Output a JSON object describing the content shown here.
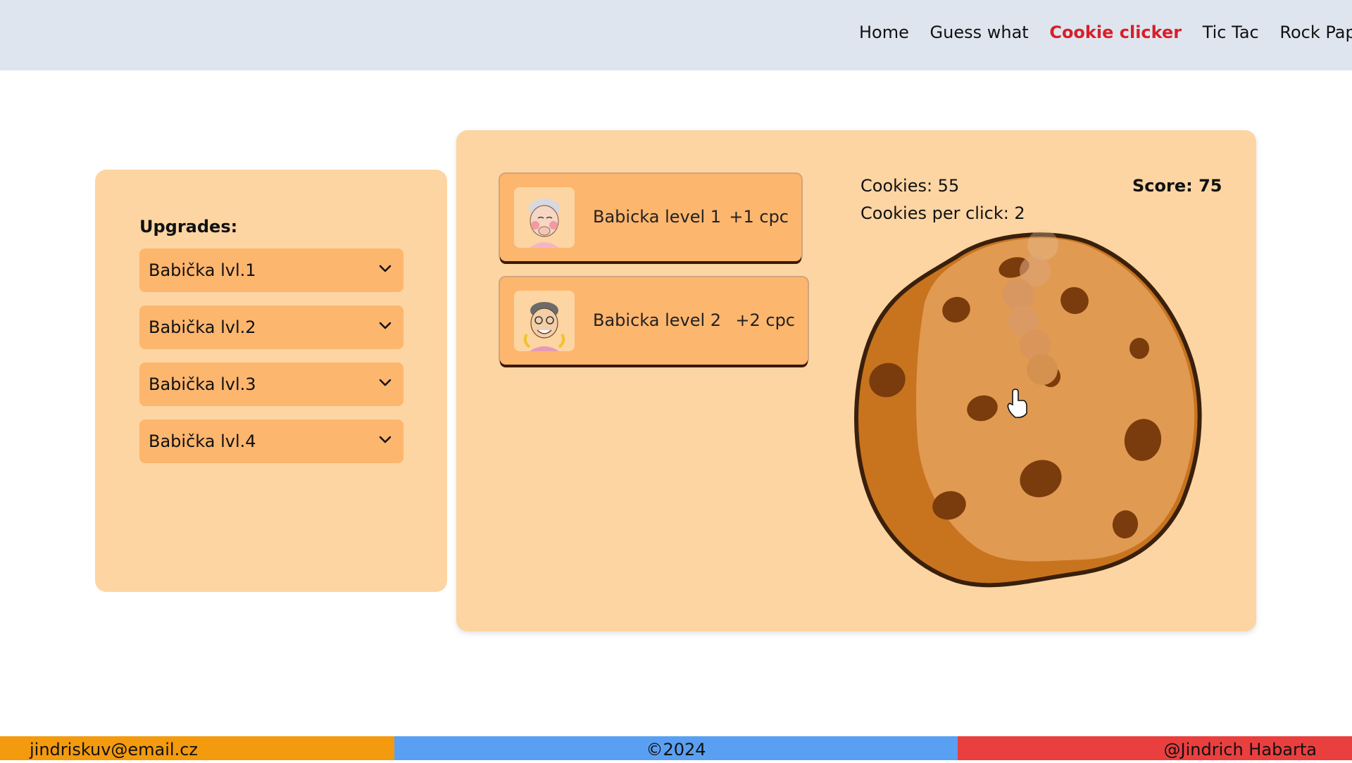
{
  "nav": {
    "items": [
      "Home",
      "Guess what",
      "Cookie clicker",
      "Tic Tac",
      "Rock Paper"
    ],
    "active": "Cookie clicker",
    "active_color": "#d61f2a"
  },
  "upgrades": {
    "title": "Upgrades:",
    "items": [
      "Babička lvl.1",
      "Babička lvl.2",
      "Babička lvl.3",
      "Babička lvl.4"
    ]
  },
  "shop": {
    "items": [
      {
        "name": "Babicka level 1",
        "cpc": "+1 cpc",
        "icon": "grandma-icon"
      },
      {
        "name": "Babicka level 2",
        "cpc": "+2 cpc",
        "icon": "grandma-icon"
      }
    ]
  },
  "stats": {
    "cookies": "Cookies: 55",
    "cpc": "Cookies per click: 2",
    "score": "Score: 75"
  },
  "footer": {
    "email": "jindriskuv@email.cz",
    "copyright": "©2024",
    "author": "@Jindrich Habarta"
  },
  "colors": {
    "topbar": "#dfe5ee",
    "panel": "#fdd5a3",
    "button": "#fdb66e",
    "footer_left": "#f39a0e",
    "footer_mid": "#5aa0f2",
    "footer_right": "#ea3f3f"
  }
}
